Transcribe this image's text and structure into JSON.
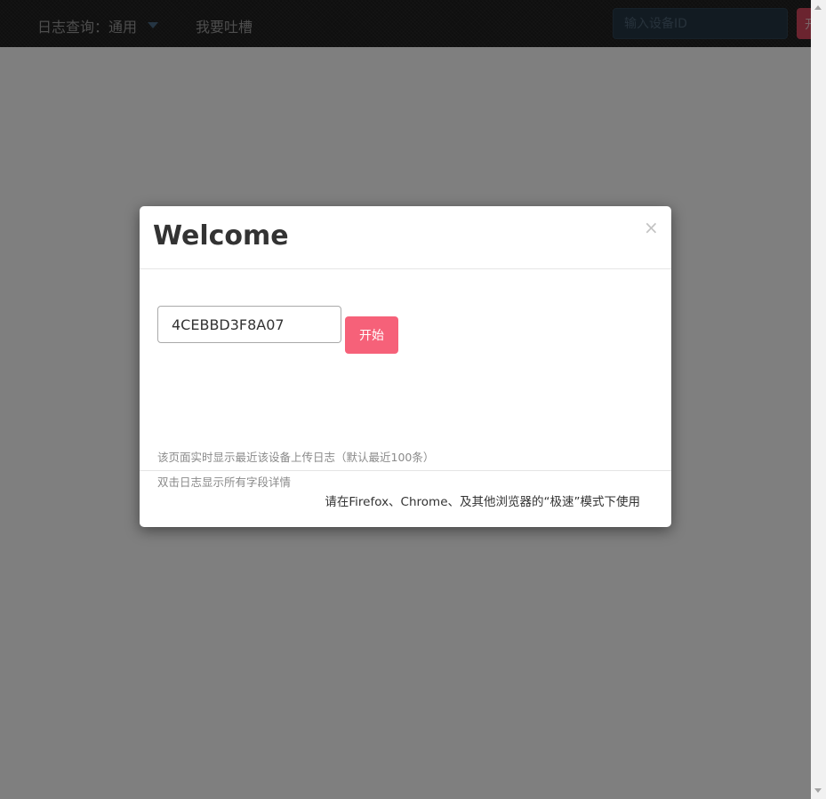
{
  "navbar": {
    "query_label": "日志查询：通用",
    "feedback_label": "我要吐槽",
    "device_input": {
      "placeholder": "输入设备ID",
      "value": ""
    },
    "start_button_label": "开"
  },
  "modal": {
    "title": "Welcome",
    "close_symbol": "×",
    "device_input_value": "4CEBBD3F8A07",
    "start_button_label": "开始",
    "hints": [
      "该页面实时显示最近该设备上传日志（默认最近100条）",
      "双击日志显示所有字段详情"
    ],
    "browser_note": "请在Firefox、Chrome、及其他浏览器的“极速”模式下使用"
  },
  "colors": {
    "navbar_bg": "#1e1e1e",
    "accent": "#f66179",
    "backdrop": "#808080"
  },
  "icons": [
    "chevron-down-icon",
    "close-icon",
    "scroll-up-arrow-icon",
    "scroll-down-arrow-icon"
  ]
}
